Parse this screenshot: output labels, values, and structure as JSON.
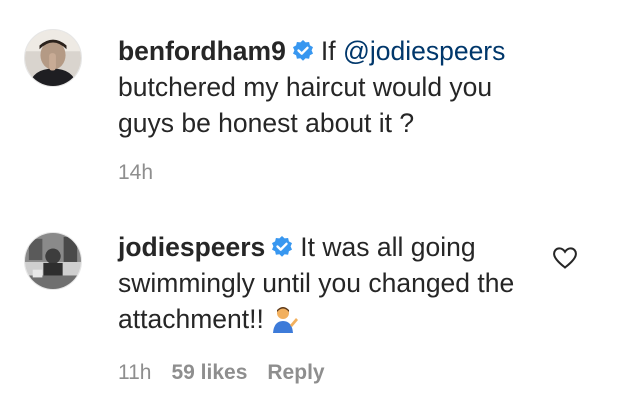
{
  "comments": [
    {
      "username": "benfordham9",
      "text_prefix": "If ",
      "mention": "@jodiespeers",
      "text_rest": "butchered my haircut would you guys be honest about it ?",
      "time": "14h"
    },
    {
      "username": "jodiespeers",
      "text": "It was all going swimmingly until you changed the attachment!!",
      "time": "11h",
      "likes": "59 likes",
      "reply_label": "Reply",
      "emoji": "person-tipping-hand-icon"
    }
  ],
  "colors": {
    "text": "#262626",
    "muted": "#8e8e8e",
    "mention": "#00376b",
    "verified": "#3897f0"
  }
}
